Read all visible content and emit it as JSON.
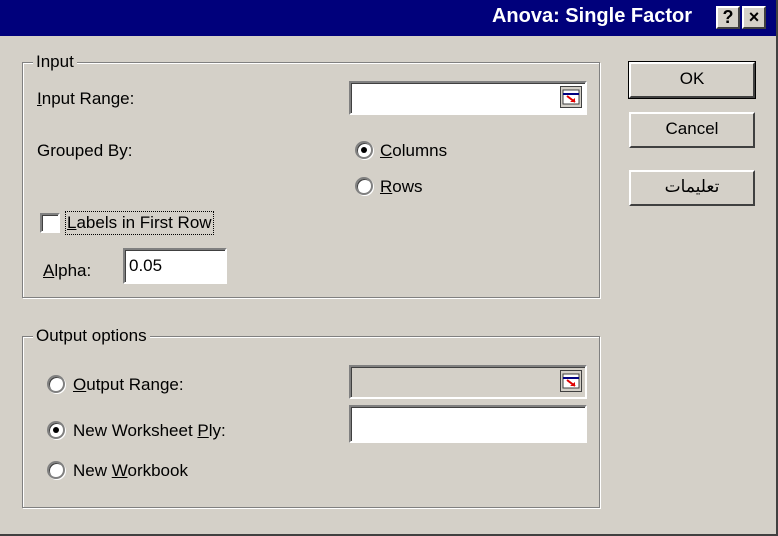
{
  "window": {
    "title": "Anova: Single Factor",
    "help_glyph": "?",
    "close_glyph": "×"
  },
  "input_group": {
    "legend": "Input",
    "input_range_label": "Input Range:",
    "input_range_value": "",
    "grouped_by_label": "Grouped By:",
    "columns_label": "Columns",
    "columns_selected": true,
    "rows_label": "Rows",
    "rows_selected": false,
    "labels_label": "Labels in First Row",
    "labels_checked": false,
    "alpha_label": "Alpha:",
    "alpha_value": "0.05"
  },
  "output_group": {
    "legend": "Output options",
    "output_range_label": "Output Range:",
    "output_range_value": "",
    "new_ply_label": "New Worksheet Ply:",
    "new_ply_selected": true,
    "new_ply_value": "",
    "new_workbook_label": "New Workbook"
  },
  "buttons": {
    "ok": "OK",
    "cancel": "Cancel",
    "help": "تعليمات"
  },
  "colors": {
    "titlebar": "#00007b",
    "face": "#d4d0c8",
    "ref_arrow": "#e00000"
  }
}
